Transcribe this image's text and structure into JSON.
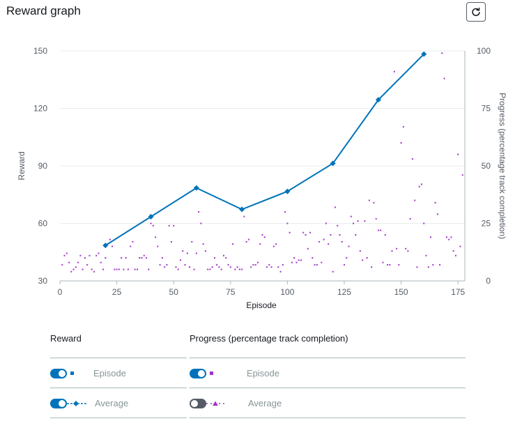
{
  "header": {
    "title": "Reward graph"
  },
  "chart_data": {
    "type": "line",
    "xlabel": "Episode",
    "ylabel": "Reward",
    "y2label": "Progress (percentage track completion)",
    "xlim": [
      0,
      178
    ],
    "ylim": [
      30,
      150
    ],
    "y2lim": [
      0,
      100
    ],
    "xticks": [
      0,
      25,
      50,
      75,
      100,
      125,
      150,
      175
    ],
    "yticks": [
      30,
      60,
      90,
      120,
      150
    ],
    "y2ticks": [
      0,
      25,
      50,
      75,
      100
    ],
    "grid": true,
    "series": [
      {
        "name": "Average",
        "axis": "left",
        "style": "line-diamond",
        "color": "#0073bb",
        "x": [
          20,
          40,
          60,
          80,
          100,
          120,
          140,
          160
        ],
        "y": [
          48.5,
          63.5,
          78.5,
          67.3,
          76.7,
          91.3,
          124.5,
          148.3
        ]
      },
      {
        "name": "Episode",
        "axis": "right",
        "style": "dots",
        "color": "#a033c8",
        "x": [
          1,
          2,
          3,
          4,
          5,
          6,
          7,
          8,
          9,
          10,
          11,
          12,
          13,
          14,
          15,
          16,
          17,
          18,
          19,
          20,
          21,
          22,
          23,
          24,
          25,
          26,
          27,
          28,
          29,
          30,
          31,
          32,
          33,
          34,
          35,
          36,
          37,
          38,
          39,
          40,
          41,
          42,
          43,
          44,
          45,
          46,
          47,
          48,
          49,
          50,
          51,
          52,
          53,
          54,
          55,
          56,
          57,
          58,
          59,
          60,
          61,
          62,
          63,
          64,
          65,
          66,
          67,
          68,
          69,
          70,
          71,
          72,
          73,
          74,
          75,
          76,
          77,
          78,
          79,
          80,
          81,
          82,
          83,
          84,
          85,
          86,
          87,
          88,
          89,
          90,
          91,
          92,
          93,
          94,
          95,
          96,
          97,
          98,
          99,
          100,
          101,
          102,
          103,
          104,
          105,
          106,
          107,
          108,
          109,
          110,
          111,
          112,
          113,
          114,
          115,
          116,
          117,
          118,
          119,
          120,
          121,
          122,
          123,
          124,
          125,
          126,
          127,
          128,
          129,
          130,
          131,
          132,
          133,
          134,
          135,
          136,
          137,
          138,
          139,
          140,
          141,
          142,
          143,
          144,
          145,
          146,
          147,
          148,
          149,
          150,
          151,
          152,
          153,
          154,
          155,
          156,
          157,
          158,
          159,
          160,
          161,
          162,
          163,
          164,
          165,
          166,
          167,
          168,
          169,
          170,
          171,
          172,
          173,
          174,
          175,
          176,
          177
        ],
        "y": [
          7,
          11,
          12,
          8,
          4,
          5,
          6,
          8,
          11,
          5,
          10,
          7,
          11,
          5,
          4,
          11,
          12,
          8,
          5,
          10,
          16,
          18,
          15,
          5,
          5,
          5,
          10,
          5,
          10,
          5,
          15,
          17,
          5,
          5,
          10,
          10,
          11,
          10,
          5,
          25,
          24,
          19,
          15,
          7,
          10,
          6,
          7,
          24,
          17,
          24,
          6,
          5,
          9,
          13,
          7,
          12,
          6,
          17,
          5,
          12,
          30,
          25,
          16,
          13,
          5,
          5,
          6,
          10,
          7,
          6,
          5,
          11,
          10,
          7,
          6,
          16,
          5,
          6,
          5,
          5,
          28,
          17,
          18,
          6,
          7,
          7,
          8,
          16,
          20,
          19,
          6,
          7,
          6,
          15,
          16,
          6,
          4,
          7,
          30,
          25,
          21,
          8,
          10,
          8,
          9,
          9,
          21,
          20,
          14,
          21,
          10,
          7,
          7,
          17,
          8,
          18,
          25,
          16,
          20,
          4,
          32,
          24,
          20,
          17,
          7,
          10,
          15,
          28,
          25,
          20,
          26,
          13,
          9,
          26,
          10,
          35,
          6,
          34,
          27,
          22,
          22,
          8,
          20,
          7,
          7,
          13,
          91,
          14,
          7,
          60,
          67,
          14,
          13,
          27,
          53,
          35,
          6,
          41,
          42,
          25,
          11,
          6,
          19,
          7,
          34,
          29,
          7,
          99,
          88,
          19,
          18,
          19,
          13,
          11,
          55,
          15,
          46
        ]
      }
    ]
  },
  "legend": {
    "reward_header": "Reward",
    "progress_header": "Progress (percentage track completion)",
    "reward_episode_label": "Episode",
    "reward_average_label": "Average",
    "progress_episode_label": "Episode",
    "progress_average_label": "Average",
    "reward_episode_on": true,
    "reward_average_on": true,
    "progress_episode_on": true,
    "progress_average_on": false
  },
  "colors": {
    "reward": "#0073bb",
    "progress": "#a033c8"
  },
  "icons": {
    "refresh": "refresh-icon"
  }
}
